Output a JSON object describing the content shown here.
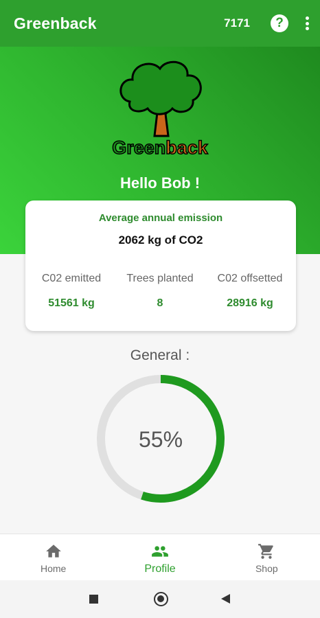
{
  "appbar": {
    "title": "Greenback",
    "points": "7171",
    "help_icon": "help-circle-icon",
    "more_icon": "more-vert-icon"
  },
  "hero": {
    "logo_text": "Greenback",
    "greeting": "Hello Bob !"
  },
  "summary": {
    "average_label": "Average annual emission",
    "average_value": "2062 kg of CO2",
    "stats": [
      {
        "label": "C02 emitted",
        "value": "51561 kg"
      },
      {
        "label": "Trees planted",
        "value": "8"
      },
      {
        "label": "C02 offsetted",
        "value": "28916 kg"
      }
    ]
  },
  "general": {
    "label": "General :",
    "percent_text": "55%",
    "progress": 0.55
  },
  "bottom_nav": {
    "items": [
      {
        "label": "Home",
        "icon": "home-icon"
      },
      {
        "label": "Profile",
        "icon": "people-icon",
        "active": true
      },
      {
        "label": "Shop",
        "icon": "cart-icon"
      }
    ]
  },
  "colors": {
    "primary": "#2ea02e",
    "accent_text": "#2e8b2e",
    "ring_track": "#e0e0e0",
    "ring_fill": "#1f9a1f"
  }
}
